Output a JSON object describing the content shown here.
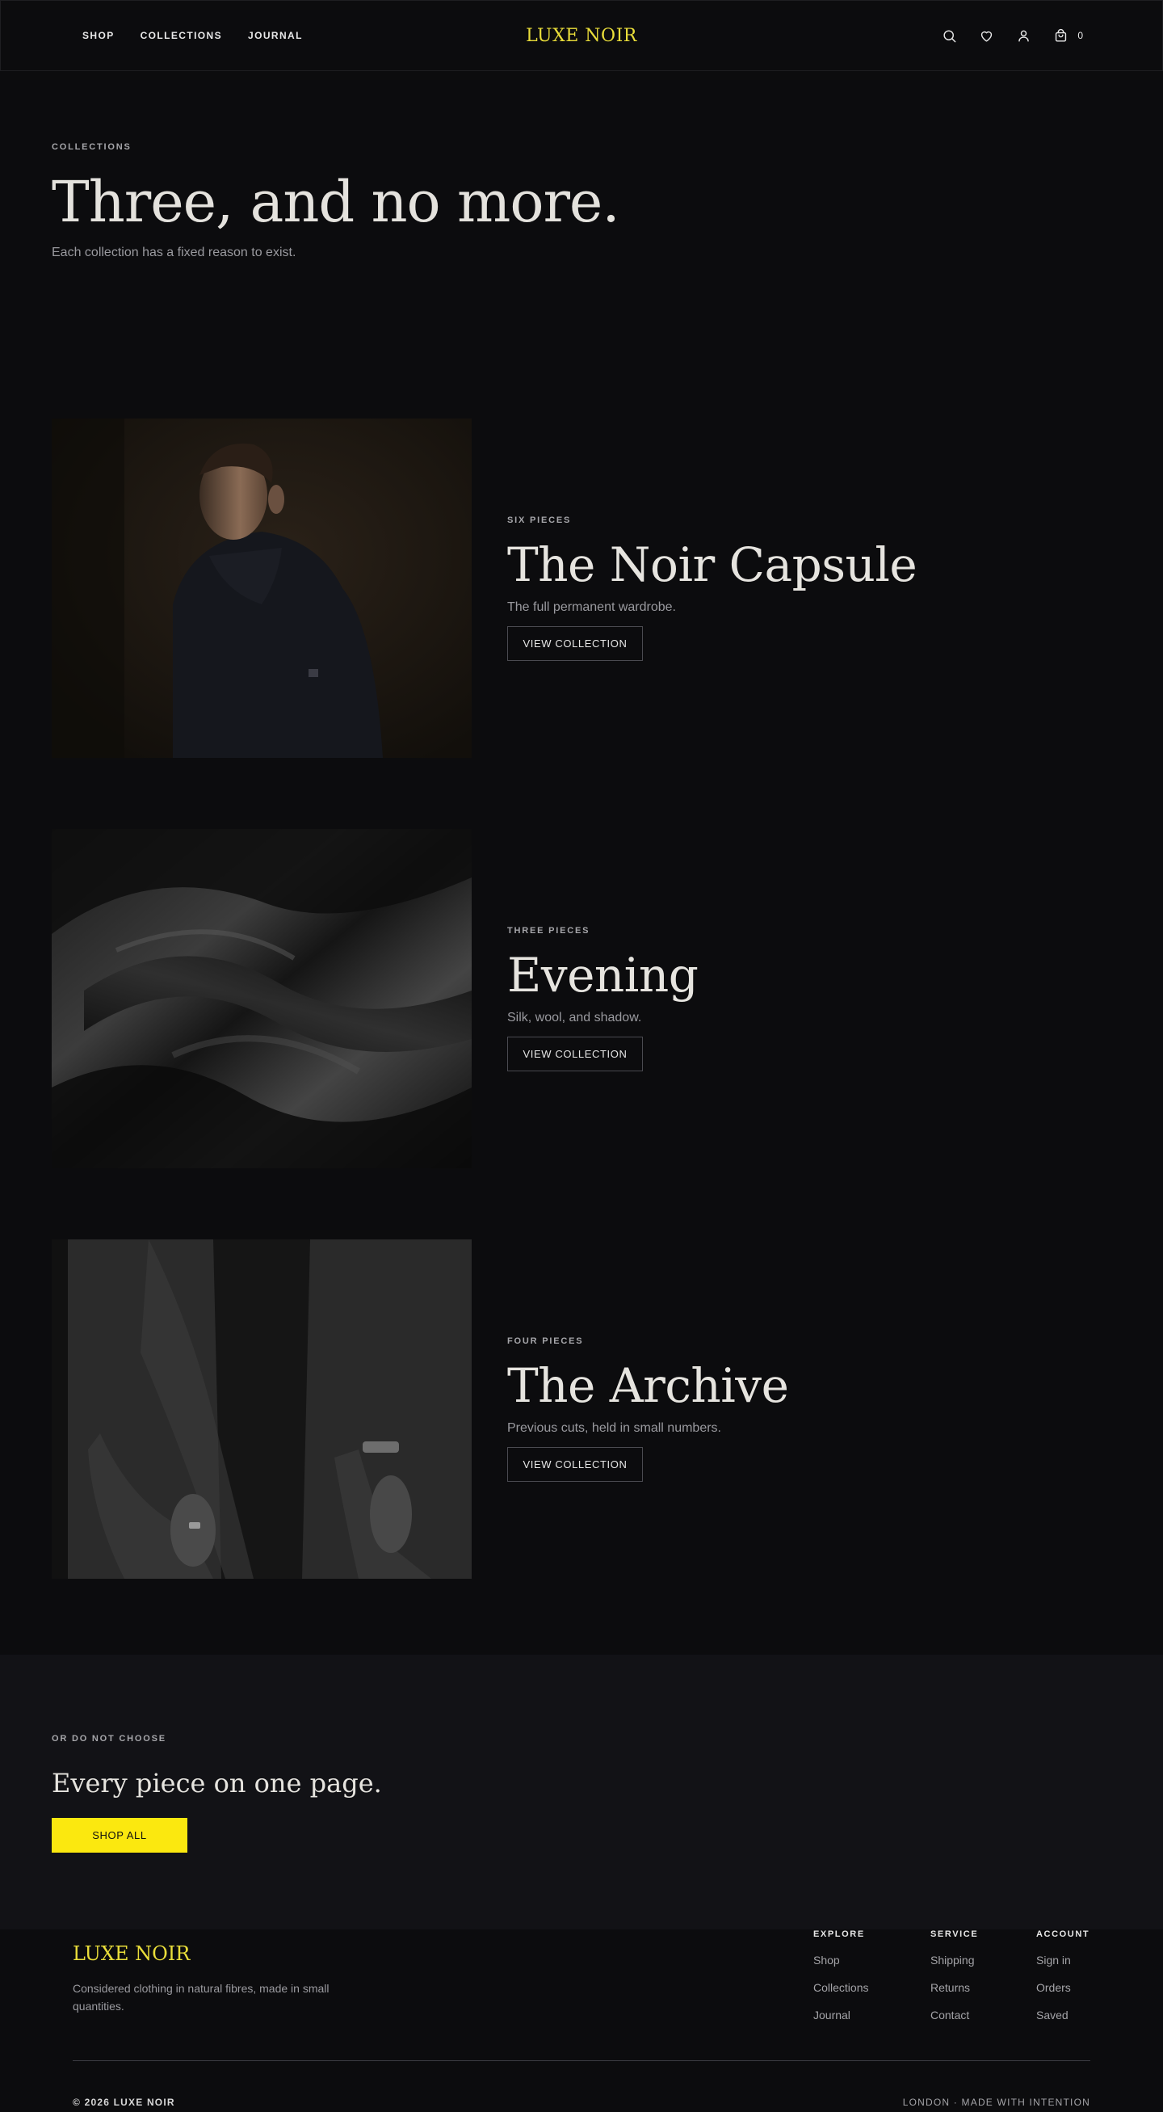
{
  "header": {
    "nav": [
      "SHOP",
      "COLLECTIONS",
      "JOURNAL"
    ],
    "logo": "LUXE NOIR",
    "cart_count": "0",
    "icons": [
      "search-icon",
      "heart-icon",
      "user-icon",
      "bag-icon"
    ]
  },
  "hero": {
    "eyebrow": "COLLECTIONS",
    "title": "Three, and no more.",
    "subtitle": "Each collection has a fixed reason to exist."
  },
  "collections": [
    {
      "count": "SIX PIECES",
      "title": "The Noir Capsule",
      "description": "The full permanent wardrobe.",
      "button": "VIEW COLLECTION",
      "image": "portrait-photo"
    },
    {
      "count": "THREE PIECES",
      "title": "Evening",
      "description": "Silk, wool, and shadow.",
      "button": "VIEW COLLECTION",
      "image": "silk-fabric-photo"
    },
    {
      "count": "FOUR PIECES",
      "title": "The Archive",
      "description": "Previous cuts, held in small numbers.",
      "button": "VIEW COLLECTION",
      "image": "coat-detail-photo"
    }
  ],
  "cta": {
    "eyebrow": "OR DO NOT CHOOSE",
    "title": "Every piece on one page.",
    "button": "SHOP ALL"
  },
  "footer": {
    "logo": "LUXE NOIR",
    "tagline": "Considered clothing in natural fibres, made in small quantities.",
    "columns": [
      {
        "heading": "EXPLORE",
        "links": [
          "Shop",
          "Collections",
          "Journal"
        ]
      },
      {
        "heading": "SERVICE",
        "links": [
          "Shipping",
          "Returns",
          "Contact"
        ]
      },
      {
        "heading": "ACCOUNT",
        "links": [
          "Sign in",
          "Orders",
          "Saved"
        ]
      }
    ],
    "copyright": "© 2026 LUXE NOIR",
    "location": "LONDON · MADE WITH INTENTION"
  },
  "colors": {
    "background": "#0c0c0e",
    "accent": "#fbe80f",
    "logo": "#e9dd3a"
  }
}
